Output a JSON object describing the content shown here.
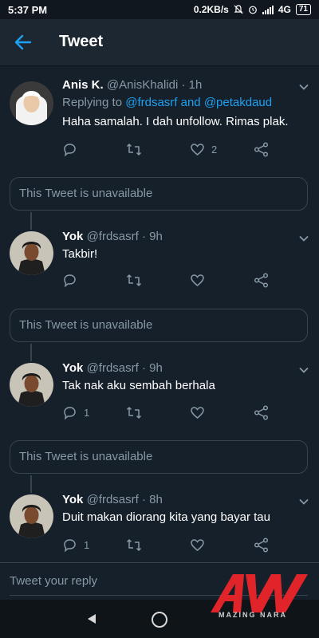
{
  "status_bar": {
    "time": "5:37 PM",
    "net_speed": "0.2KB/s",
    "network": "4G",
    "battery": "71"
  },
  "header": {
    "title": "Tweet"
  },
  "tweets": [
    {
      "name": "Anis K.",
      "handle": "@AnisKhalidi",
      "time": "· 1h",
      "replying_label": "Replying to",
      "replying_users": "@frdsasrf and @petakdaud",
      "text": "Haha samalah. I dah unfollow. Rimas plak.",
      "reply_count": "",
      "like_count": "2"
    },
    {
      "name": "Yok",
      "handle": "@frdsasrf",
      "time": "· 9h",
      "text": "Takbir!",
      "reply_count": "",
      "like_count": ""
    },
    {
      "name": "Yok",
      "handle": "@frdsasrf",
      "time": "· 9h",
      "text": "Tak nak aku sembah berhala",
      "reply_count": "1",
      "like_count": ""
    },
    {
      "name": "Yok",
      "handle": "@frdsasrf",
      "time": "· 8h",
      "text": "Duit makan diorang kita yang bayar tau",
      "reply_count": "1",
      "like_count": ""
    }
  ],
  "unavailable_text": "This Tweet is unavailable",
  "reply_bar": {
    "placeholder": "Tweet your reply"
  },
  "watermark": {
    "text": "MAZING NARA"
  },
  "colors": {
    "background": "#15202b",
    "accent": "#1da1f2",
    "muted": "#8899a6",
    "border": "#38444d",
    "watermark_red": "#e0242a"
  }
}
